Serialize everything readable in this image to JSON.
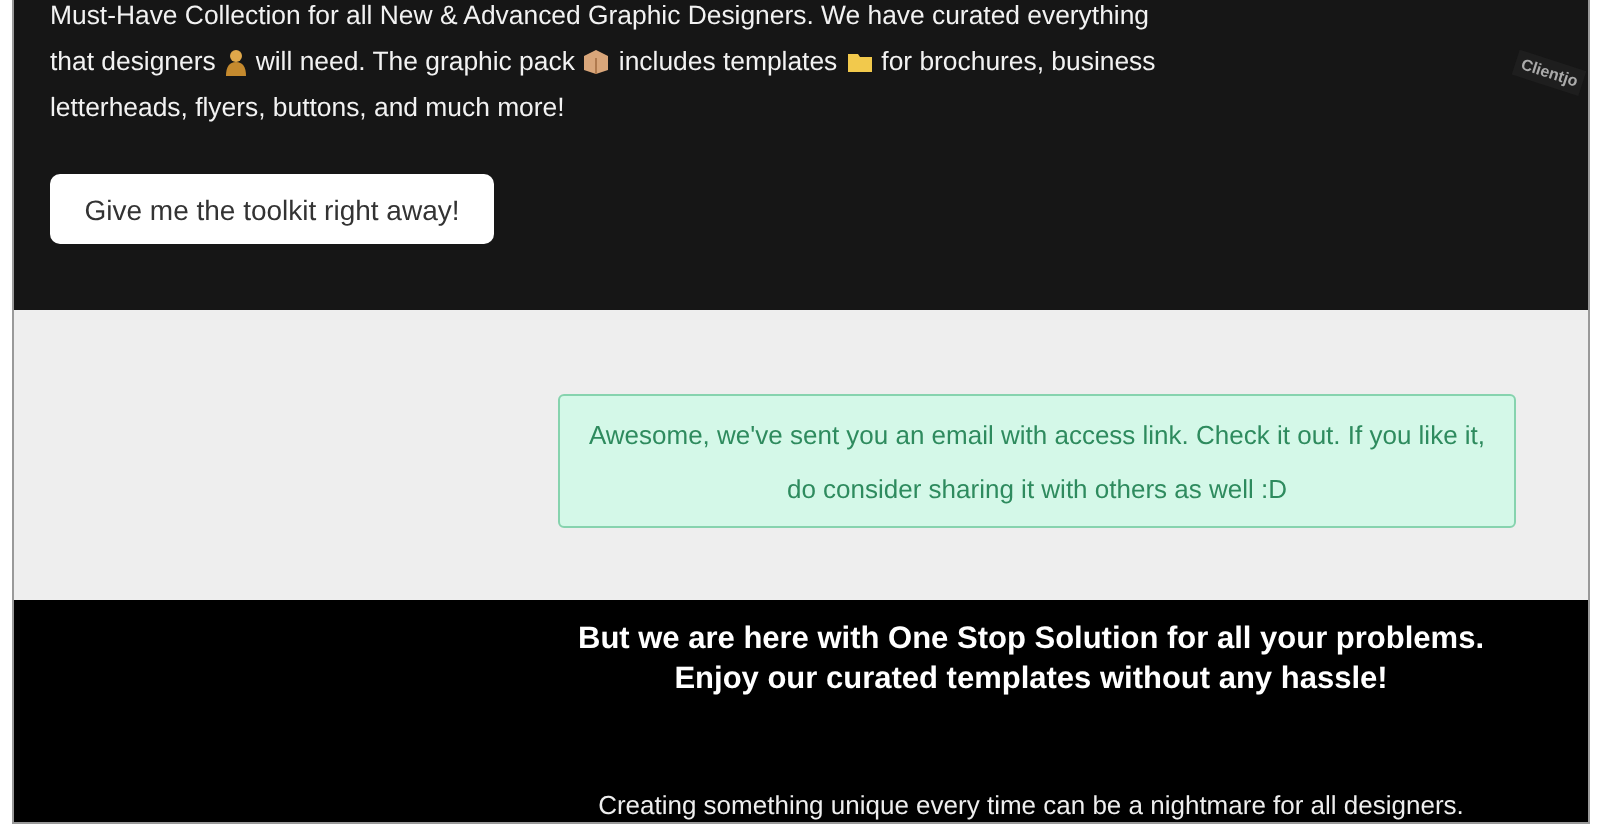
{
  "intro": {
    "lines": [
      [
        {
          "kind": "text",
          "text": "Must-Have Collection for all New & Advanced Graphic Designers. We have curated everything"
        }
      ],
      [
        {
          "kind": "text",
          "text": "that designers"
        },
        {
          "kind": "person"
        },
        {
          "kind": "text",
          "text": "will need. The graphic pack"
        },
        {
          "kind": "box"
        },
        {
          "kind": "text",
          "text": "includes templates"
        },
        {
          "kind": "folder"
        },
        {
          "kind": "text",
          "text": "for brochures, business"
        }
      ],
      [
        {
          "kind": "text",
          "text": "letterheads, flyers, buttons, and much more!"
        }
      ]
    ],
    "button": "Give me the toolkit right away!",
    "badge": "Clientjo"
  },
  "alert": {
    "lines": [
      "Awesome, we've sent you an email with access link. Check it out. If you like it,",
      "do consider sharing it with others as well :D"
    ]
  },
  "promo": {
    "heading": [
      "But we are here with One Stop Solution for all your problems.",
      "Enjoy our curated templates without any hassle!"
    ],
    "body": "Creating something unique every time can be a nightmare for all designers."
  }
}
